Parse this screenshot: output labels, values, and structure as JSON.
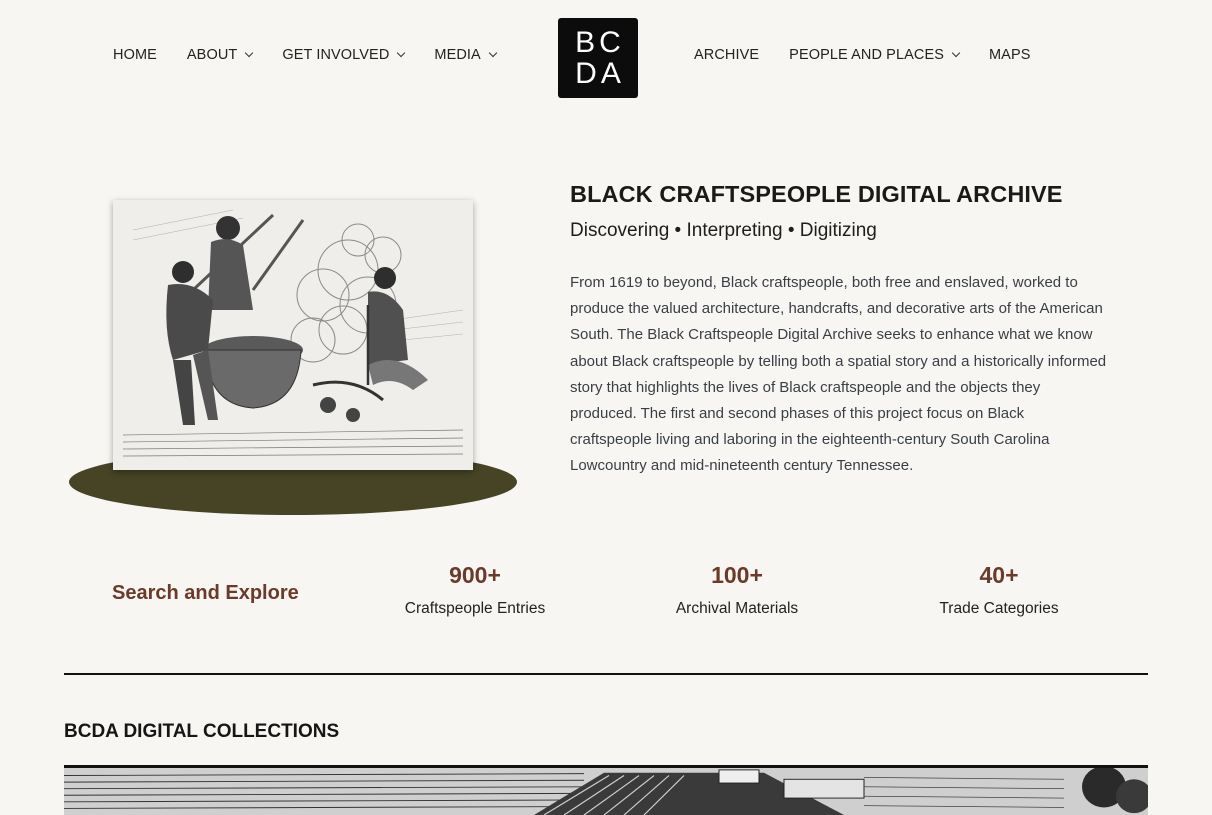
{
  "nav": {
    "left": [
      {
        "label": "HOME",
        "dropdown": false
      },
      {
        "label": "ABOUT",
        "dropdown": true
      },
      {
        "label": "GET INVOLVED",
        "dropdown": true
      },
      {
        "label": "MEDIA",
        "dropdown": true
      }
    ],
    "right": [
      {
        "label": "ARCHIVE",
        "dropdown": false
      },
      {
        "label": "PEOPLE AND PLACES",
        "dropdown": true
      },
      {
        "label": "MAPS",
        "dropdown": false
      }
    ]
  },
  "logo": {
    "line1": "BC",
    "line2": "DA"
  },
  "hero": {
    "title": "BLACK CRAFTSPEOPLE DIGITAL ARCHIVE",
    "subtitle": "Discovering • Interpreting • Digitizing",
    "body": "From 1619 to beyond, Black craftspeople, both free and enslaved, worked to produce the valued architecture, handcrafts, and decorative arts of the American South. The Black Craftspeople Digital Archive seeks to enhance what we know about Black craftspeople by telling both a spatial story and a historically informed story that highlights the lives of Black craftspeople and the objects they produced. The first and second phases of this project focus on Black craftspeople living and laboring in the eighteenth-century South Carolina Lowcountry and mid-nineteenth century Tennessee."
  },
  "stats": {
    "search_label": "Search and Explore",
    "items": [
      {
        "number": "900+",
        "label": "Craftspeople Entries"
      },
      {
        "number": "100+",
        "label": "Archival Materials"
      },
      {
        "number": "40+",
        "label": "Trade Categories"
      }
    ]
  },
  "collections": {
    "title": "BCDA DIGITAL COLLECTIONS"
  },
  "colors": {
    "background": "#f7f6f2",
    "accent": "#6b3a28",
    "ellipse": "#464424",
    "logo_bg": "#0c0c0c"
  }
}
